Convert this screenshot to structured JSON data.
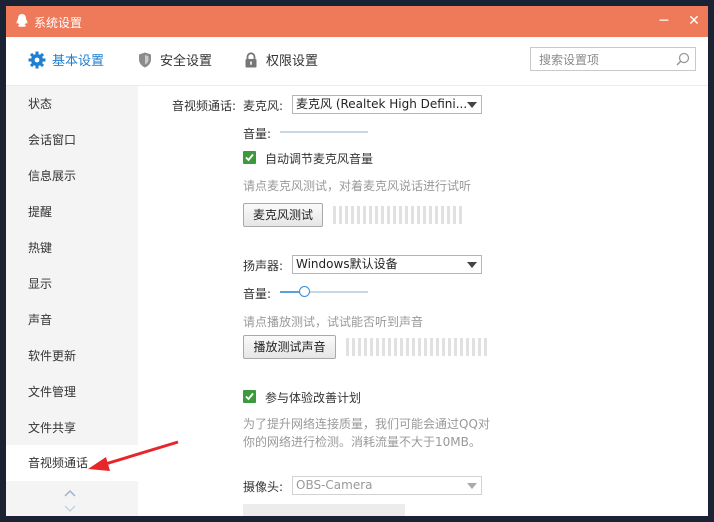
{
  "window": {
    "title": "系统设置",
    "minimize": "─",
    "close": "✕"
  },
  "tabs": [
    {
      "label": "基本设置",
      "icon": "gear-icon"
    },
    {
      "label": "安全设置",
      "icon": "shield-icon"
    },
    {
      "label": "权限设置",
      "icon": "lock-icon"
    }
  ],
  "search": {
    "placeholder": "搜索设置项",
    "icon": "search-icon"
  },
  "sidebar": {
    "items": [
      "状态",
      "会话窗口",
      "信息展示",
      "提醒",
      "热键",
      "显示",
      "声音",
      "软件更新",
      "文件管理",
      "文件共享",
      "音视频通话"
    ],
    "active_index": 10
  },
  "av": {
    "section_label": "音视频通话:",
    "mic_label": "麦克风:",
    "mic_value": "麦克风 (Realtek High Defini...",
    "volume_label": "音量:",
    "auto_adjust_label": "自动调节麦克风音量",
    "mic_hint": "请点麦克风测试，对着麦克风说话进行试听",
    "mic_test_button": "麦克风测试",
    "speaker_label": "扬声器:",
    "speaker_value": "Windows默认设备",
    "speaker_volume_label": "音量:",
    "speaker_volume_level": 0.27,
    "speaker_hint": "请点播放测试，试试能否听到声音",
    "speaker_test_button": "播放测试声音",
    "improve_label": "参与体验改善计划",
    "improve_desc_line1": "为了提升网络连接质量，我们可能会通过QQ对",
    "improve_desc_line2": "你的网络进行检测。消耗流量不大于10MB。",
    "camera_label": "摄像头:",
    "camera_value": "OBS-Camera"
  },
  "colors": {
    "titlebar": "#ef7a5a",
    "accent": "#1f7fd0",
    "check": "#3c9a3c",
    "annotation_arrow": "#e8262a"
  }
}
